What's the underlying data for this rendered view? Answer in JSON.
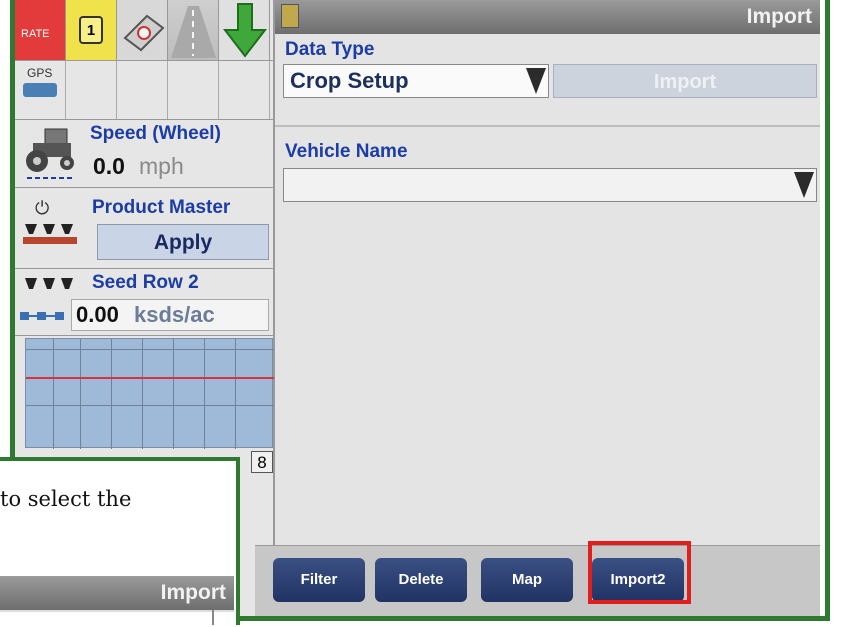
{
  "status": {
    "rate_label": "RATE",
    "mode_number": "1",
    "gps_label": "GPS"
  },
  "speed": {
    "title": "Speed (Wheel)",
    "value": "0.0",
    "unit": "mph"
  },
  "product_master": {
    "title": "Product Master",
    "button": "Apply"
  },
  "seed_row": {
    "title": "Seed Row 2",
    "value": "0.00",
    "unit": "ksds/ac"
  },
  "section_grid": {
    "last_number": "8"
  },
  "import_screen": {
    "title": "Import",
    "data_type_label": "Data Type",
    "data_type_value": "Crop Setup",
    "import_button": "Import",
    "vehicle_name_label": "Vehicle Name",
    "vehicle_name_value": ""
  },
  "bottom_buttons": [
    "Filter",
    "Delete",
    "Map",
    "Import2"
  ],
  "callout": {
    "text": "to select the",
    "title": "Import"
  },
  "colors": {
    "frame": "#2f7a30",
    "highlight": "#e21d1d",
    "label_blue": "#1c3da6"
  }
}
